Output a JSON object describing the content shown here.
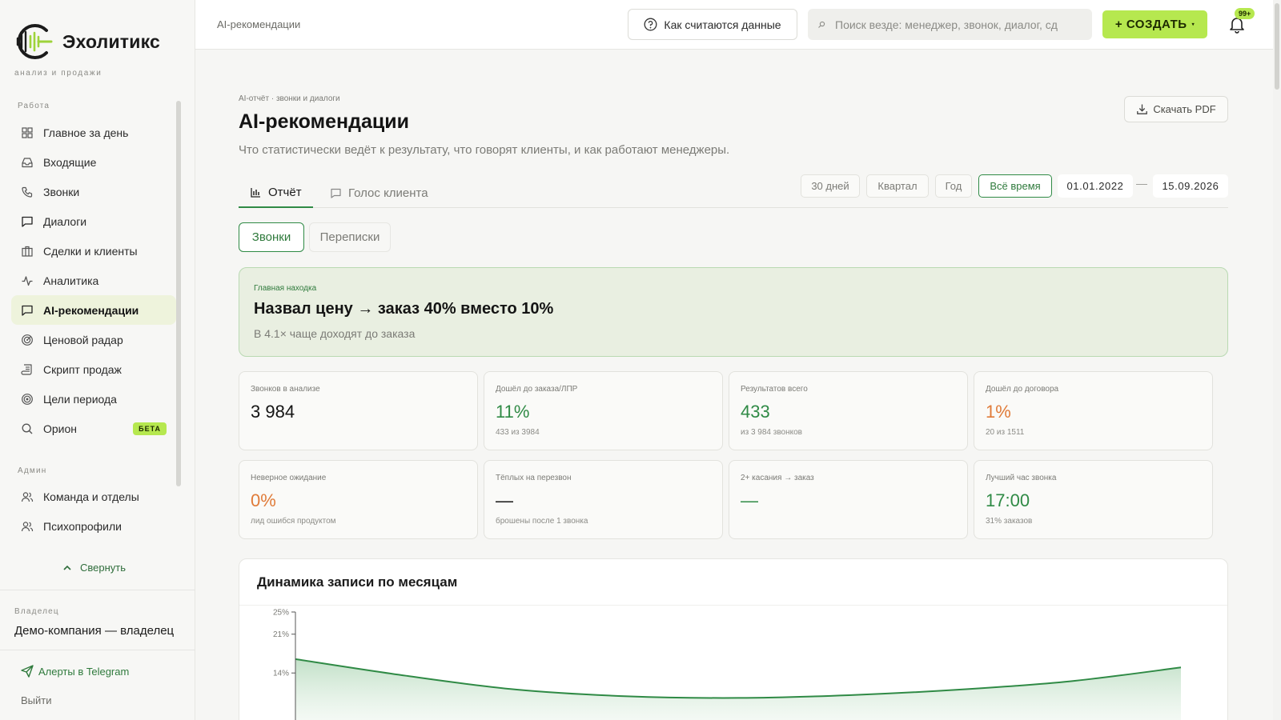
{
  "brand": {
    "name": "Эхолитикс",
    "tagline": "анализ и продажи"
  },
  "sidebar": {
    "work_label": "Работа",
    "work_items": [
      {
        "label": "Главное за день",
        "icon": "dashboard-icon"
      },
      {
        "label": "Входящие",
        "icon": "inbox-icon"
      },
      {
        "label": "Звонки",
        "icon": "phone-icon"
      },
      {
        "label": "Диалоги",
        "icon": "chat-icon"
      },
      {
        "label": "Сделки и клиенты",
        "icon": "briefcase-icon"
      },
      {
        "label": "Аналитика",
        "icon": "pulse-icon"
      },
      {
        "label": "AI-рекомендации",
        "icon": "chat-icon",
        "active": true
      },
      {
        "label": "Ценовой радар",
        "icon": "radar-icon"
      },
      {
        "label": "Скрипт продаж",
        "icon": "script-icon"
      },
      {
        "label": "Цели периода",
        "icon": "target-icon"
      },
      {
        "label": "Орион",
        "icon": "search-icon",
        "badge": "БЕТА"
      }
    ],
    "admin_label": "Админ",
    "admin_items": [
      {
        "label": "Команда и отделы",
        "icon": "users-icon"
      },
      {
        "label": "Психопрофили",
        "icon": "users-icon"
      }
    ],
    "collapse_label": "Свернуть",
    "owner_label": "Владелец",
    "owner_name": "Демо-компания — владелец",
    "telegram_label": "Алерты в Telegram",
    "logout_label": "Выйти"
  },
  "topbar": {
    "breadcrumb": "AI-рекомендации",
    "how_label": "Как считаются данные",
    "search_placeholder": "Поиск везде: менеджер, звонок, диалог, сд",
    "create_label": "+ СОЗДАТЬ",
    "create_caret": "▾",
    "bell_badge": "99+"
  },
  "page": {
    "small_crumb": "AI-отчёт · звонки и диалоги",
    "title": "AI-рекомендации",
    "subtitle": "Что статистически ведёт к результату, что говорят клиенты, и как работают менеджеры.",
    "pdf_label": "Скачать PDF",
    "tabs": [
      {
        "label": "Отчёт",
        "active": true
      },
      {
        "label": "Голос клиента",
        "active": false
      }
    ],
    "ranges": [
      {
        "label": "30 дней",
        "active": false
      },
      {
        "label": "Квартал",
        "active": false
      },
      {
        "label": "Год",
        "active": false
      },
      {
        "label": "Всё время",
        "active": true
      }
    ],
    "date_from": "01.01.2022",
    "date_to": "15.09.2026",
    "date_dash": "—",
    "segments": [
      {
        "label": "Звонки",
        "active": true
      },
      {
        "label": "Переписки",
        "active": false
      }
    ]
  },
  "hero": {
    "label": "Главная находка",
    "title": "Назвал цену → заказ 40% вместо 10%",
    "subtitle": "В 4.1× чаще доходят до заказа"
  },
  "colors": {
    "accent": "#b6e84f",
    "green": "#2f8a45",
    "orange": "#e07b39",
    "dark": "#141414"
  },
  "cards": [
    {
      "label": "Звонков в анализе",
      "value": "3 984",
      "sub": "",
      "tone": "dark"
    },
    {
      "label": "Дошёл до заказа/ЛПР",
      "value": "11%",
      "sub": "433 из 3984",
      "tone": "green"
    },
    {
      "label": "Результатов всего",
      "value": "433",
      "sub": "из 3 984 звонков",
      "tone": "green"
    },
    {
      "label": "Дошёл до договора",
      "value": "1%",
      "sub": "20 из 1511",
      "tone": "orange"
    },
    {
      "label": "Неверное ожидание",
      "value": "0%",
      "sub": "лид ошибся продуктом",
      "tone": "orange"
    },
    {
      "label": "Тёплых на перезвон",
      "value": "—",
      "sub": "брошены после 1 звонка",
      "tone": "dark"
    },
    {
      "label": "2+ касания → заказ",
      "value": "—",
      "sub": "",
      "tone": "green"
    },
    {
      "label": "Лучший час звонка",
      "value": "17:00",
      "sub": "31% заказов",
      "tone": "green"
    }
  ],
  "chart_data": {
    "type": "area",
    "title": "Динамика записи по месяцам",
    "y_ticks": [
      "25%",
      "21%",
      "14%"
    ],
    "y_tick_values": [
      25,
      21,
      14
    ],
    "ylim": [
      0,
      25
    ],
    "series": [
      {
        "values": [
          16.5,
          13.5,
          11.0,
          9.8,
          9.5,
          10.0,
          11.0,
          12.5,
          15.0
        ]
      }
    ]
  }
}
